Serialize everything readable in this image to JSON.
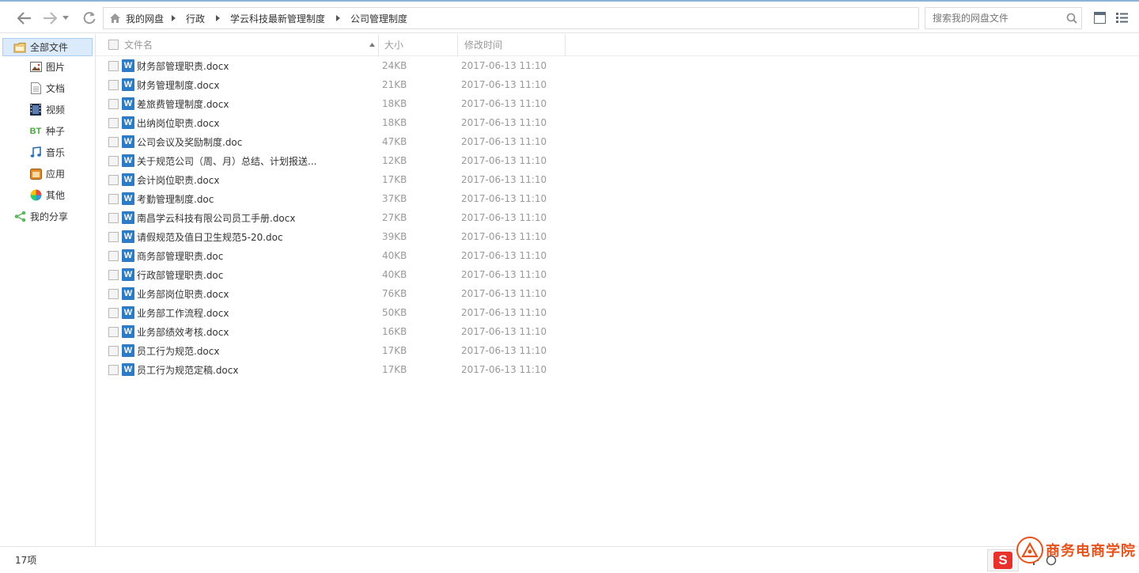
{
  "toolbar": {
    "breadcrumb": [
      "我的网盘",
      "行政",
      "学云科技最新管理制度",
      "公司管理制度"
    ],
    "search_placeholder": "搜索我的网盘文件"
  },
  "sidebar": {
    "items": [
      {
        "label": "全部文件",
        "icon": "folder-icon"
      },
      {
        "label": "图片",
        "icon": "picture-icon"
      },
      {
        "label": "文档",
        "icon": "document-icon"
      },
      {
        "label": "视频",
        "icon": "video-icon"
      },
      {
        "label": "种子",
        "icon": "bt-icon"
      },
      {
        "label": "音乐",
        "icon": "music-icon"
      },
      {
        "label": "应用",
        "icon": "app-icon"
      },
      {
        "label": "其他",
        "icon": "other-icon"
      },
      {
        "label": "我的分享",
        "icon": "share-icon"
      }
    ]
  },
  "list": {
    "headers": {
      "name": "文件名",
      "size": "大小",
      "modified": "修改时间"
    },
    "files": [
      {
        "name": "财务部管理职责.docx",
        "size": "24KB",
        "time": "2017-06-13 11:10"
      },
      {
        "name": "财务管理制度.docx",
        "size": "21KB",
        "time": "2017-06-13 11:10"
      },
      {
        "name": "差旅费管理制度.docx",
        "size": "18KB",
        "time": "2017-06-13 11:10"
      },
      {
        "name": "出纳岗位职责.docx",
        "size": "18KB",
        "time": "2017-06-13 11:10"
      },
      {
        "name": "公司会议及奖励制度.doc",
        "size": "47KB",
        "time": "2017-06-13 11:10"
      },
      {
        "name": "关于规范公司（周、月）总结、计划报送...",
        "size": "12KB",
        "time": "2017-06-13 11:10"
      },
      {
        "name": "会计岗位职责.docx",
        "size": "17KB",
        "time": "2017-06-13 11:10"
      },
      {
        "name": "考勤管理制度.doc",
        "size": "37KB",
        "time": "2017-06-13 11:10"
      },
      {
        "name": "南昌学云科技有限公司员工手册.docx",
        "size": "27KB",
        "time": "2017-06-13 11:10"
      },
      {
        "name": "请假规范及值日卫生规范5-20.doc",
        "size": "39KB",
        "time": "2017-06-13 11:10"
      },
      {
        "name": "商务部管理职责.doc",
        "size": "40KB",
        "time": "2017-06-13 11:10"
      },
      {
        "name": "行政部管理职责.doc",
        "size": "40KB",
        "time": "2017-06-13 11:10"
      },
      {
        "name": "业务部岗位职责.docx",
        "size": "76KB",
        "time": "2017-06-13 11:10"
      },
      {
        "name": "业务部工作流程.docx",
        "size": "50KB",
        "time": "2017-06-13 11:10"
      },
      {
        "name": "业务部绩效考核.docx",
        "size": "16KB",
        "time": "2017-06-13 11:10"
      },
      {
        "name": "员工行为规范.docx",
        "size": "17KB",
        "time": "2017-06-13 11:10"
      },
      {
        "name": "员工行为规范定稿.docx",
        "size": "17KB",
        "time": "2017-06-13 11:10"
      }
    ],
    "file_icon_letter": "W"
  },
  "status": {
    "count": "17项"
  },
  "watermark": {
    "text": "商务电商学院",
    "logo_letter": "S"
  },
  "colors": {
    "accent": "#2c7bc4",
    "selected_bg": "#dcebfb",
    "watermark": "#e5541d"
  }
}
